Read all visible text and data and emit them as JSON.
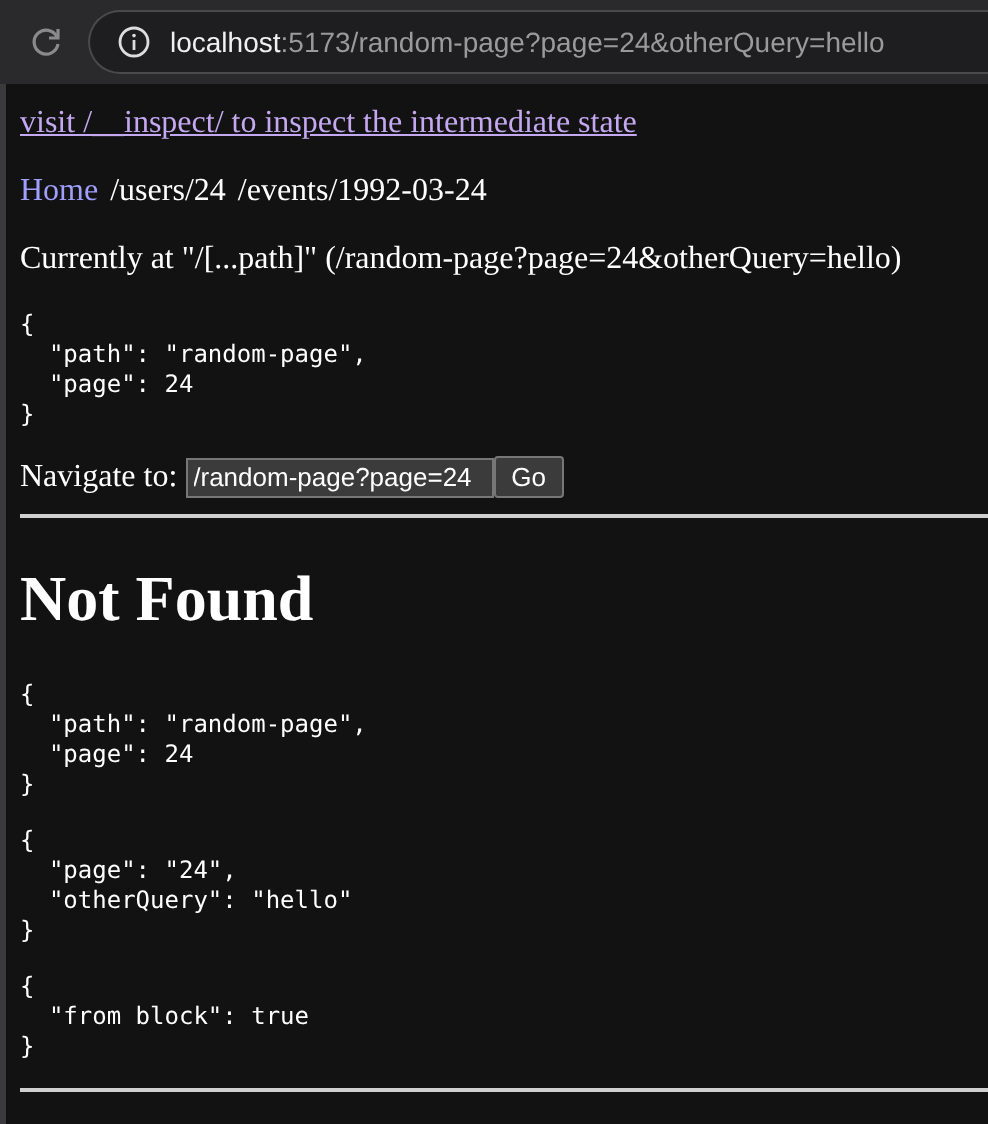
{
  "browser": {
    "address_host": "localhost",
    "address_rest": ":5173/random-page?page=24&otherQuery=hello"
  },
  "inspect_link": "visit /__inspect/ to inspect the intermediate state",
  "breadcrumbs": [
    {
      "label": "Home",
      "link": true
    },
    {
      "label": "/users/24",
      "link": false
    },
    {
      "label": "/events/1992-03-24",
      "link": false
    }
  ],
  "current": "Currently at \"/[...path]\" (/random-page?page=24&otherQuery=hello)",
  "params_json": "{\n  \"path\": \"random-page\",\n  \"page\": 24\n}",
  "navigate": {
    "label": "Navigate to:",
    "value": "/random-page?page=24",
    "button": "Go"
  },
  "heading": "Not Found",
  "json_blocks": [
    "{\n  \"path\": \"random-page\",\n  \"page\": 24\n}",
    "{\n  \"page\": \"24\",\n  \"otherQuery\": \"hello\"\n}",
    "{\n  \"from block\": true\n}"
  ]
}
